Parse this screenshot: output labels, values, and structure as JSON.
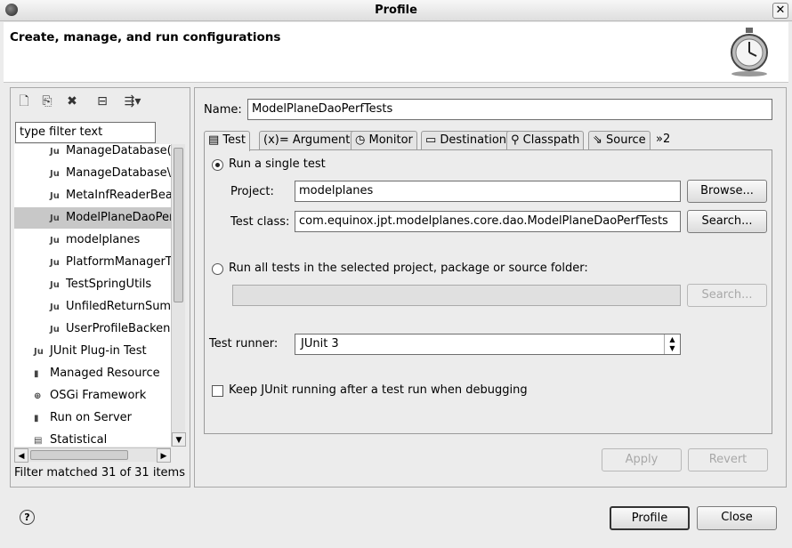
{
  "window": {
    "title": "Profile"
  },
  "header": {
    "title": "Create, manage, and run configurations"
  },
  "left": {
    "filter_placeholder": "type filter text",
    "tree_items": [
      {
        "label": "ManageDatabase(",
        "icon": "Ju"
      },
      {
        "label": "ManageDatabase\\",
        "icon": "Ju"
      },
      {
        "label": "MetaInfReaderBea",
        "icon": "Ju"
      },
      {
        "label": "ModelPlaneDaoPer",
        "icon": "Ju"
      },
      {
        "label": "modelplanes",
        "icon": "Ju"
      },
      {
        "label": "PlatformManagerT",
        "icon": "Ju"
      },
      {
        "label": "TestSpringUtils",
        "icon": "Ju"
      },
      {
        "label": "UnfiledReturnSumi",
        "icon": "Ju"
      },
      {
        "label": "UserProfileBacken",
        "icon": "Ju"
      },
      {
        "label": "JUnit Plug-in Test",
        "icon": "Ju"
      },
      {
        "label": "Managed Resource",
        "icon": "▮"
      },
      {
        "label": "OSGi Framework",
        "icon": "⊕"
      },
      {
        "label": "Run on Server",
        "icon": "▮"
      },
      {
        "label": "Statistical",
        "icon": "▤"
      }
    ],
    "status": "Filter matched 31 of 31 items"
  },
  "config": {
    "name_label": "Name:",
    "name_value": "ModelPlaneDaoPerfTests",
    "tabs": [
      {
        "label": "Test"
      },
      {
        "label": "Arguments"
      },
      {
        "label": "Monitor"
      },
      {
        "label": "Destination"
      },
      {
        "label": "Classpath"
      },
      {
        "label": "Source"
      },
      {
        "label": "»2"
      }
    ],
    "single_test_label": "Run a single test",
    "project_label": "Project:",
    "project_value": "modelplanes",
    "browse_button": "Browse...",
    "test_class_label": "Test class:",
    "test_class_value": "com.equinox.jpt.modelplanes.core.dao.ModelPlaneDaoPerfTests",
    "search_button": "Search...",
    "all_tests_label": "Run all tests in the selected project, package or source folder:",
    "all_tests_search_button": "Search...",
    "runner_label": "Test runner:",
    "runner_value": "JUnit 3",
    "keep_running_label": "Keep JUnit running after a test run when debugging",
    "apply_button": "Apply",
    "revert_button": "Revert"
  },
  "footer": {
    "profile_button": "Profile",
    "close_button": "Close",
    "help_symbol": "?"
  }
}
